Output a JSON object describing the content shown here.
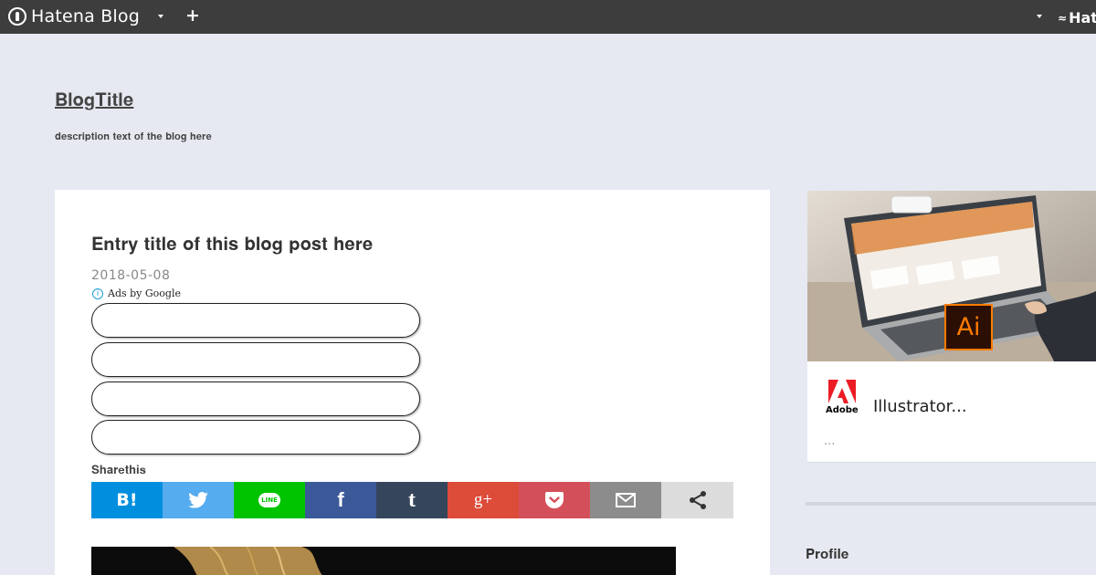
{
  "topbar": {
    "logo_text": "Hatena Blog",
    "right_brand": "Hat",
    "plus_icon": "plus-icon",
    "dropdown_icon": "caret-down-icon"
  },
  "blog": {
    "title": "𝐁𝐥𝐨𝐠𝐓𝐢𝐭𝐥𝐞",
    "description": "𝐝𝐞𝐬𝐜𝐫𝐢𝐩𝐭𝐢𝐨𝐧 𝐭𝐞𝐱𝐭 𝐨𝐟 𝐭𝐡𝐞 𝐛𝐥𝐨𝐠 𝐡𝐞𝐫𝐞"
  },
  "article": {
    "title": "𝐄𝐧𝐭𝐫𝐲 𝐭𝐢𝐭𝐥𝐞 𝐨𝐟 𝐭𝐡𝐢𝐬 𝐛𝐥𝐨𝐠 𝐩𝐨𝐬𝐭 𝐡𝐞𝐫𝐞",
    "date": "2018-05-08",
    "ads_label": "Ads by Google",
    "ad_links": [
      "",
      "",
      "",
      ""
    ],
    "share_heading": "𝐒𝐡𝐚𝐫𝐞𝐭𝐡𝐢𝐬",
    "share_buttons": [
      {
        "label": "B!",
        "icon": "hatena-bookmark-icon",
        "color": "#008fde"
      },
      {
        "label": "",
        "icon": "twitter-icon",
        "color": "#55acee"
      },
      {
        "label": "LINE",
        "icon": "line-icon",
        "color": "#00c300"
      },
      {
        "label": "f",
        "icon": "facebook-icon",
        "color": "#3b5998"
      },
      {
        "label": "t",
        "icon": "tumblr-icon",
        "color": "#35465c"
      },
      {
        "label": "g+",
        "icon": "google-plus-icon",
        "color": "#dd4b39"
      },
      {
        "label": "",
        "icon": "pocket-icon",
        "color": "#d3505a"
      },
      {
        "label": "",
        "icon": "email-icon",
        "color": "#8c8c8c"
      },
      {
        "label": "",
        "icon": "share-icon",
        "color": "#dcdcdc"
      }
    ]
  },
  "sidebar": {
    "ad": {
      "brand": "Adobe",
      "title": "Illustrator...",
      "subtitle": "...",
      "product_badge": "Ai"
    },
    "section_heading": "𝐏𝐫𝐨𝐟𝐢𝐥𝐞"
  },
  "colors": {
    "topbar": "#3d3d3d",
    "page_bg": "#e6e9f1",
    "adobe_red": "#ec1c24",
    "ai_orange": "#ff7c00"
  }
}
